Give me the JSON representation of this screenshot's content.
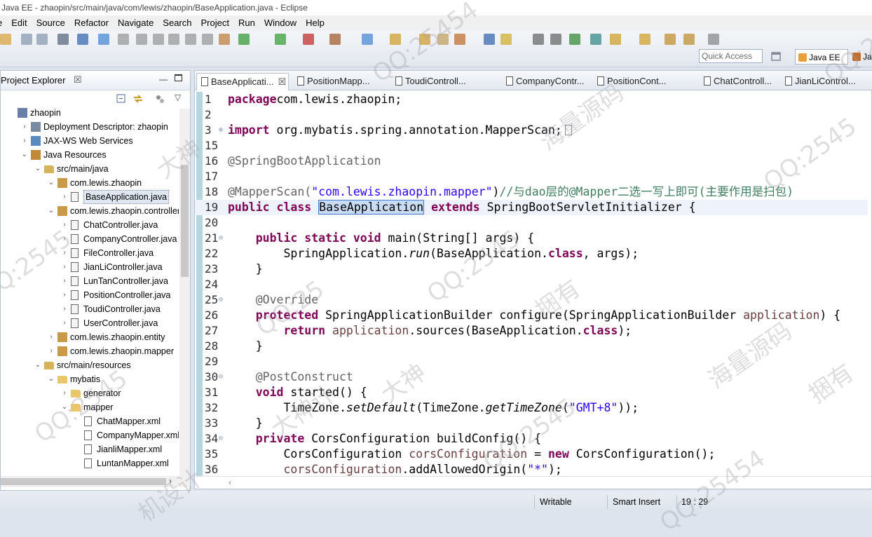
{
  "window": {
    "title": "Java EE - zhaopin/src/main/java/com/lewis/zhaopin/BaseApplication.java - Eclipse"
  },
  "menu": [
    "e",
    "Edit",
    "Source",
    "Refactor",
    "Navigate",
    "Search",
    "Project",
    "Run",
    "Window",
    "Help"
  ],
  "toolbar": {
    "quick_access_placeholder": "Quick Access",
    "perspective_label": "Java EE",
    "perspective_label2": "Ja"
  },
  "project_explorer": {
    "title": "Project Explorer",
    "close": "☒",
    "tree": [
      {
        "label": "zhaopin",
        "level": 0,
        "arrow": "",
        "icon": "project-icon"
      },
      {
        "label": "Deployment Descriptor: zhaopin",
        "level": 1,
        "arrow": "›",
        "icon": "descriptor-icon"
      },
      {
        "label": "JAX-WS Web Services",
        "level": 1,
        "arrow": "›",
        "icon": "webservices-icon"
      },
      {
        "label": "Java Resources",
        "level": 1,
        "arrow": "⌄",
        "icon": "java-resources-icon"
      },
      {
        "label": "src/main/java",
        "level": 2,
        "arrow": "⌄",
        "icon": "source-folder-icon"
      },
      {
        "label": "com.lewis.zhaopin",
        "level": 3,
        "arrow": "⌄",
        "icon": "package-icon"
      },
      {
        "label": "BaseApplication.java",
        "level": 4,
        "arrow": "›",
        "icon": "java-file-icon",
        "selected": true
      },
      {
        "label": "com.lewis.zhaopin.controller",
        "level": 3,
        "arrow": "⌄",
        "icon": "package-icon"
      },
      {
        "label": "ChatController.java",
        "level": 4,
        "arrow": "›",
        "icon": "java-file-icon"
      },
      {
        "label": "CompanyController.java",
        "level": 4,
        "arrow": "›",
        "icon": "java-file-icon"
      },
      {
        "label": "FileController.java",
        "level": 4,
        "arrow": "›",
        "icon": "java-file-icon"
      },
      {
        "label": "JianLiController.java",
        "level": 4,
        "arrow": "›",
        "icon": "java-file-icon"
      },
      {
        "label": "LunTanController.java",
        "level": 4,
        "arrow": "›",
        "icon": "java-file-icon"
      },
      {
        "label": "PositionController.java",
        "level": 4,
        "arrow": "›",
        "icon": "java-file-icon"
      },
      {
        "label": "ToudiController.java",
        "level": 4,
        "arrow": "›",
        "icon": "java-file-icon"
      },
      {
        "label": "UserController.java",
        "level": 4,
        "arrow": "›",
        "icon": "java-file-icon"
      },
      {
        "label": "com.lewis.zhaopin.entity",
        "level": 3,
        "arrow": "›",
        "icon": "package-icon"
      },
      {
        "label": "com.lewis.zhaopin.mapper",
        "level": 3,
        "arrow": "›",
        "icon": "package-icon"
      },
      {
        "label": "src/main/resources",
        "level": 2,
        "arrow": "⌄",
        "icon": "source-folder-icon"
      },
      {
        "label": "mybatis",
        "level": 3,
        "arrow": "⌄",
        "icon": "folder-icon"
      },
      {
        "label": "generator",
        "level": 4,
        "arrow": "›",
        "icon": "folder-icon"
      },
      {
        "label": "mapper",
        "level": 4,
        "arrow": "⌄",
        "icon": "folder-icon"
      },
      {
        "label": "ChatMapper.xml",
        "level": 5,
        "arrow": "",
        "icon": "xml-file-icon"
      },
      {
        "label": "CompanyMapper.xml",
        "level": 5,
        "arrow": "",
        "icon": "xml-file-icon"
      },
      {
        "label": "JianliMapper.xml",
        "level": 5,
        "arrow": "",
        "icon": "xml-file-icon"
      },
      {
        "label": "LuntanMapper.xml",
        "level": 5,
        "arrow": "",
        "icon": "xml-file-icon"
      }
    ]
  },
  "editor": {
    "tabs": [
      {
        "label": "BaseApplicati...",
        "active": true,
        "close": "☒"
      },
      {
        "label": "PositionMapp...",
        "active": false
      },
      {
        "label": "ToudiControll...",
        "active": false
      },
      {
        "label": "CompanyContr...",
        "active": false
      },
      {
        "label": "PositionCont...",
        "active": false
      },
      {
        "label": "ChatControll...",
        "active": false
      },
      {
        "label": "JianLiControl...",
        "active": false
      }
    ],
    "lines": [
      {
        "n": "1",
        "fold": "",
        "segs": [
          [
            "kw",
            "package"
          ],
          [
            "",
            "com.lewis.zhaopin;"
          ]
        ]
      },
      {
        "n": "2",
        "fold": "",
        "segs": []
      },
      {
        "n": "3",
        "fold": "⊕",
        "segs": [
          [
            "kw",
            "import"
          ],
          [
            "",
            " org.mybatis.spring.annotation.MapperScan;"
          ],
          [
            "box",
            "  "
          ]
        ]
      },
      {
        "n": "15",
        "fold": "",
        "segs": []
      },
      {
        "n": "16",
        "fold": "",
        "segs": [
          [
            "ann",
            "@SpringBootApplication"
          ]
        ]
      },
      {
        "n": "17",
        "fold": "",
        "segs": []
      },
      {
        "n": "18",
        "fold": "",
        "segs": [
          [
            "ann",
            "@MapperScan("
          ],
          [
            "str",
            "\"com.lewis.zhaopin.mapper\""
          ],
          [
            "",
            ")"
          ],
          [
            "cmt",
            "//与dao层的@Mapper二选一写上即可(主要作用是扫包)"
          ]
        ]
      },
      {
        "n": "19",
        "fold": "",
        "current": true,
        "segs": [
          [
            "kw",
            "public"
          ],
          [
            "",
            " "
          ],
          [
            "kw",
            "class"
          ],
          [
            "",
            " "
          ],
          [
            "sel",
            "BaseApplication"
          ],
          [
            "",
            " "
          ],
          [
            "kw",
            "extends"
          ],
          [
            "",
            " SpringBootServletInitializer {"
          ]
        ]
      },
      {
        "n": "20",
        "fold": "",
        "segs": []
      },
      {
        "n": "21",
        "fold": "⊖",
        "segs": [
          [
            "",
            "    "
          ],
          [
            "kw",
            "public"
          ],
          [
            "",
            " "
          ],
          [
            "kw",
            "static"
          ],
          [
            "",
            " "
          ],
          [
            "kw",
            "void"
          ],
          [
            "",
            " main(String[] args) {"
          ]
        ]
      },
      {
        "n": "22",
        "fold": "",
        "segs": [
          [
            "",
            "        SpringApplication."
          ],
          [
            "it",
            "run"
          ],
          [
            "",
            "(BaseApplication."
          ],
          [
            "kw",
            "class"
          ],
          [
            "",
            ", args);"
          ]
        ]
      },
      {
        "n": "23",
        "fold": "",
        "segs": [
          [
            "",
            "    }"
          ]
        ]
      },
      {
        "n": "24",
        "fold": "",
        "segs": []
      },
      {
        "n": "25",
        "fold": "⊖",
        "segs": [
          [
            "",
            "    "
          ],
          [
            "ann",
            "@Override"
          ]
        ]
      },
      {
        "n": "26",
        "fold": "",
        "segs": [
          [
            "",
            "    "
          ],
          [
            "kw",
            "protected"
          ],
          [
            "",
            " SpringApplicationBuilder configure(SpringApplicationBuilder "
          ],
          [
            "fld",
            "application"
          ],
          [
            "",
            ") {"
          ]
        ]
      },
      {
        "n": "27",
        "fold": "",
        "segs": [
          [
            "",
            "        "
          ],
          [
            "kw",
            "return"
          ],
          [
            "",
            " "
          ],
          [
            "fld",
            "application"
          ],
          [
            "",
            ".sources(BaseApplication."
          ],
          [
            "kw",
            "class"
          ],
          [
            "",
            ");"
          ]
        ]
      },
      {
        "n": "28",
        "fold": "",
        "segs": [
          [
            "",
            "    }"
          ]
        ]
      },
      {
        "n": "29",
        "fold": "",
        "segs": []
      },
      {
        "n": "30",
        "fold": "⊖",
        "segs": [
          [
            "",
            "    "
          ],
          [
            "ann",
            "@PostConstruct"
          ]
        ]
      },
      {
        "n": "31",
        "fold": "",
        "segs": [
          [
            "",
            "    "
          ],
          [
            "kw",
            "void"
          ],
          [
            "",
            " started() {"
          ]
        ]
      },
      {
        "n": "32",
        "fold": "",
        "segs": [
          [
            "",
            "        TimeZone."
          ],
          [
            "it",
            "setDefault"
          ],
          [
            "",
            "(TimeZone."
          ],
          [
            "it",
            "getTimeZone"
          ],
          [
            "",
            "("
          ],
          [
            "str",
            "\"GMT+8\""
          ],
          [
            "",
            "));"
          ]
        ]
      },
      {
        "n": "33",
        "fold": "",
        "segs": [
          [
            "",
            "    }"
          ]
        ]
      },
      {
        "n": "34",
        "fold": "⊖",
        "segs": [
          [
            "",
            "    "
          ],
          [
            "kw",
            "private"
          ],
          [
            "",
            " CorsConfiguration buildConfig() {"
          ]
        ]
      },
      {
        "n": "35",
        "fold": "",
        "segs": [
          [
            "",
            "        CorsConfiguration "
          ],
          [
            "fld",
            "corsConfiguration"
          ],
          [
            "",
            " = "
          ],
          [
            "kw",
            "new"
          ],
          [
            "",
            " CorsConfiguration();"
          ]
        ]
      },
      {
        "n": "36",
        "fold": "",
        "segs": [
          [
            "",
            "        "
          ],
          [
            "fld",
            "corsConfiguration"
          ],
          [
            "",
            ".addAllowedOrigin("
          ],
          [
            "str",
            "\"*\""
          ],
          [
            "",
            ");"
          ]
        ]
      }
    ]
  },
  "status": {
    "writable": "Writable",
    "insert_mode": "Smart Insert",
    "position": "19 : 29"
  },
  "watermarks": [
    "QQ:2545",
    "QQ:2545",
    "QQ:2545",
    "QQ:2545",
    "QQ:2545",
    "大神",
    "大神",
    "捆有",
    "捆有",
    "海量源码",
    "海量源码",
    "大神计",
    "QQ:25",
    "QQ:25",
    "机设计",
    "QQ:25454",
    "QQ:25454"
  ]
}
